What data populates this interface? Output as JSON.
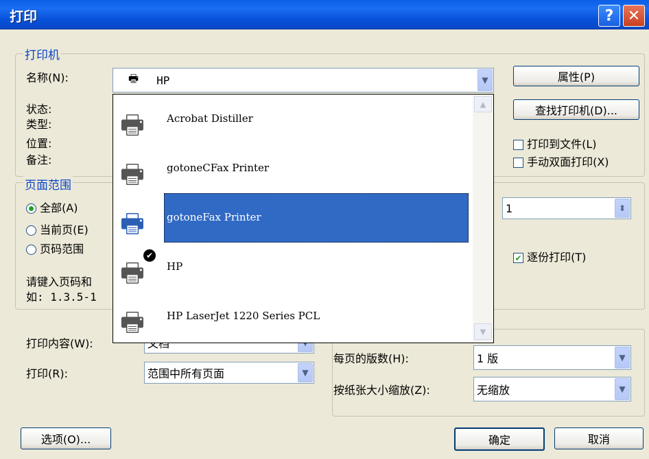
{
  "window": {
    "title": "打印",
    "help_label": "?",
    "close_label": "✕"
  },
  "printer_group": {
    "title": "打印机",
    "name_label": "名称(N):",
    "selected_printer": "HP",
    "status_label": "状态:",
    "type_label": "类型:",
    "location_label": "位置:",
    "comment_label": "备注:",
    "properties_button": "属性(P)",
    "find_printer_button": "查找打印机(D)...",
    "print_to_file": {
      "label": "打印到文件(L)",
      "checked": false
    },
    "manual_duplex": {
      "label": "手动双面打印(X)",
      "checked": false
    }
  },
  "printer_dropdown": {
    "items": [
      {
        "name": "Acrobat Distiller",
        "selected": false,
        "default": false
      },
      {
        "name": "gotoneCFax Printer",
        "selected": false,
        "default": false
      },
      {
        "name": "gotoneFax Printer",
        "selected": true,
        "default": false
      },
      {
        "name": "HP",
        "selected": false,
        "default": true
      },
      {
        "name": "HP LaserJet 1220 Series PCL",
        "selected": false,
        "default": false
      }
    ]
  },
  "page_range": {
    "title": "页面范围",
    "all": "全部(A)",
    "current": "当前页(E)",
    "pages": "页码范围",
    "hint_line1": "请键入页码和",
    "hint_line2": "如: 1.3.5-1",
    "selected": "all"
  },
  "copies": {
    "value": "1",
    "collate_label": "逐份打印(T)",
    "collate_checked": true
  },
  "print_what": {
    "label": "打印内容(W):",
    "value": "文档"
  },
  "print_range": {
    "label": "打印(R):",
    "value": "范围中所有页面"
  },
  "zoom": {
    "pages_per_sheet_label": "每页的版数(H):",
    "pages_per_sheet_value": "1 版",
    "scale_label": "按纸张大小缩放(Z):",
    "scale_value": "无缩放"
  },
  "footer": {
    "options_button": "选项(O)...",
    "ok_button": "确定",
    "cancel_button": "取消"
  },
  "colors": {
    "title_bar": "#0a5fe6",
    "dialog_bg": "#ece9d8",
    "group_title": "#0b45c8",
    "selection": "#316ac5"
  }
}
